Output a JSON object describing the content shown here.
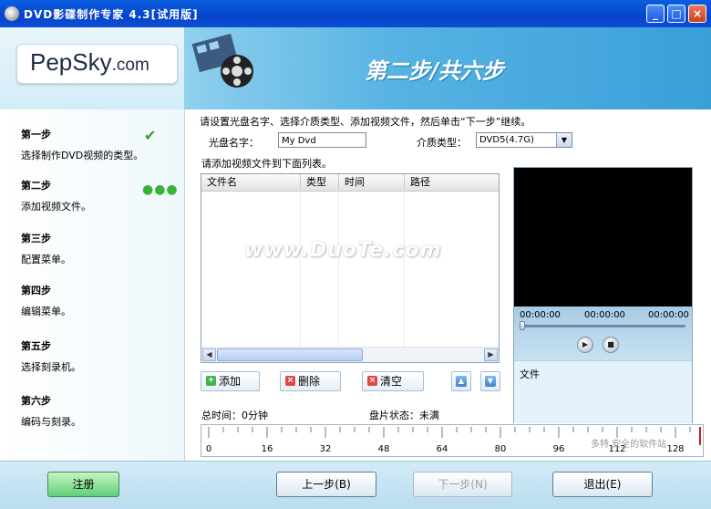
{
  "window": {
    "title": "DVD影碟制作专家 4.3[试用版]"
  },
  "logo": {
    "brand": "PepSky",
    "suffix": ".com"
  },
  "banner": {
    "step_title": "第二步/共六步"
  },
  "steps": [
    {
      "h": "第一步",
      "d": "选择制作DVD视频的类型。"
    },
    {
      "h": "第二步",
      "d": "添加视频文件。"
    },
    {
      "h": "第三步",
      "d": "配置菜单。"
    },
    {
      "h": "第四步",
      "d": "编辑菜单。"
    },
    {
      "h": "第五步",
      "d": "选择刻录机。"
    },
    {
      "h": "第六步",
      "d": "编码与刻录。"
    }
  ],
  "status_marks": {
    "done": "✔",
    "current": "●●●"
  },
  "form": {
    "instruction": "请设置光盘名字、选择介质类型、添加视频文件，然后单击“下一步”继续。",
    "disc_label": "光盘名字：",
    "disc_value": "My Dvd",
    "media_label": "介质类型：",
    "media_value": "DVD5(4.7G)"
  },
  "list": {
    "hint": "请添加视频文件到下面列表。",
    "columns": [
      "文件名",
      "类型",
      "时间",
      "路径"
    ]
  },
  "watermark": "www.DuoTe.com",
  "actions": {
    "add": "添加",
    "delete": "删除",
    "clear": "清空"
  },
  "player": {
    "t1": "00:00:00",
    "t2": "00:00:00",
    "t3": "00:00:00",
    "file_label": "文件"
  },
  "status": {
    "total_time": "总时间：0分钟",
    "disc_state": "盘片状态：未满"
  },
  "ruler_ticks": [
    "0",
    "16",
    "32",
    "48",
    "64",
    "80",
    "96",
    "112",
    "128"
  ],
  "footer": {
    "register": "注册",
    "prev": "上一步(B)",
    "next": "下一步(N)",
    "exit": "退出(E)"
  },
  "corner_mark": "多特 安全的软件站"
}
